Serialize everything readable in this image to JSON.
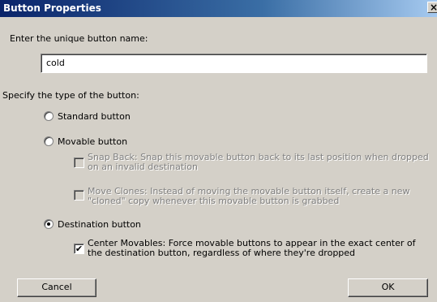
{
  "window": {
    "title": "Button Properties",
    "close_label": "×"
  },
  "name_section": {
    "label": "Enter the unique button name:",
    "value": "cold"
  },
  "type_section": {
    "label": "Specify the type of the button:"
  },
  "options": {
    "standard": {
      "label": "Standard button",
      "selected": false
    },
    "movable": {
      "label": "Movable button",
      "selected": false
    },
    "snap_back": {
      "label": "Snap Back: Snap this movable button back to its last position when dropped on an invalid destination",
      "checked": false,
      "enabled": false
    },
    "move_clones": {
      "label": "Move Clones: Instead of moving the movable button itself, create a new \"cloned\" copy whenever this movable button is grabbed",
      "checked": false,
      "enabled": false
    },
    "destination": {
      "label": "Destination button",
      "selected": true
    },
    "center_movables": {
      "label": "Center Movables: Force movable buttons to appear in the exact center of the destination button, regardless of where they're dropped",
      "checked": true,
      "enabled": true,
      "check_glyph": "✔"
    }
  },
  "buttons": {
    "cancel": "Cancel",
    "ok": "OK"
  }
}
